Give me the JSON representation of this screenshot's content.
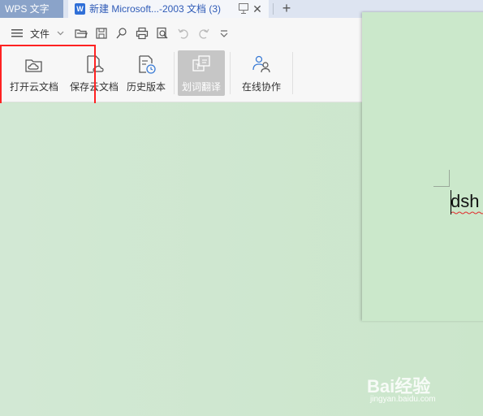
{
  "tabbar": {
    "app_tab": "WPS 文字",
    "doc_tab": "新建 Microsoft...-2003 文档 (3)",
    "doc_icon_letter": "W",
    "close_glyph": "✕",
    "add_glyph": "+"
  },
  "quickbar": {
    "file_label": "文件",
    "icons": [
      "open-folder-icon",
      "save-icon",
      "format-painter-icon",
      "print-icon",
      "print-preview-icon",
      "undo-icon",
      "redo-icon",
      "customize-dropdown-icon"
    ]
  },
  "ribbon": {
    "open_cloud": "打开云文档",
    "save_cloud": "保存云文档",
    "history": "历史版本",
    "translate": "划词翻译",
    "collab": "在线协作"
  },
  "document": {
    "text": "dsh"
  },
  "watermark": {
    "logo": "Bai经验",
    "url": "jingyan.baidu.com"
  },
  "colors": {
    "app_tab_bg": "#8aa3c9",
    "doc_tab_text": "#2f5bb7",
    "highlight_box": "#ff2222",
    "workspace_bg": "#cfe7cf"
  }
}
